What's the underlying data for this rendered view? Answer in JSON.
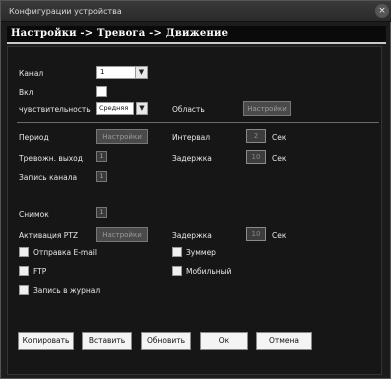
{
  "window": {
    "title": "Конфигурации устройства",
    "close_glyph": "×"
  },
  "breadcrumb": "Настройки -> Тревога -> Движение",
  "fields": {
    "channel_label": "Канал",
    "channel_value": "1",
    "enable_label": "Вкл",
    "sensitivity_label": "чувствительность",
    "sensitivity_value": "Средняя",
    "area_label": "Область",
    "area_button": "Настройки",
    "period_label": "Период",
    "period_button": "Настройки",
    "interval_label": "Интервал",
    "interval_value": "2",
    "interval_unit": "Сек",
    "alarm_out_label": "Тревожн. выход",
    "alarm_out_value": "1",
    "delay_label": "Задержка",
    "delay_value": "10",
    "delay_unit": "Сек",
    "record_channel_label": "Запись канала",
    "record_channel_value": "1",
    "snapshot_label": "Снимок",
    "snapshot_value": "1",
    "ptz_label": "Активация PTZ",
    "ptz_button": "Настройки",
    "delay2_label": "Задержка",
    "delay2_value": "10",
    "delay2_unit": "Сек",
    "send_email_label": "Отправка E-mail",
    "buzzer_label": "Зуммер",
    "ftp_label": "FTP",
    "mobile_label": "Мобильный",
    "log_label": "Запись в журнал"
  },
  "buttons": {
    "copy": "Копировать",
    "paste": "Вставить",
    "refresh": "Обновить",
    "ok": "Ок",
    "cancel": "Отмена"
  }
}
